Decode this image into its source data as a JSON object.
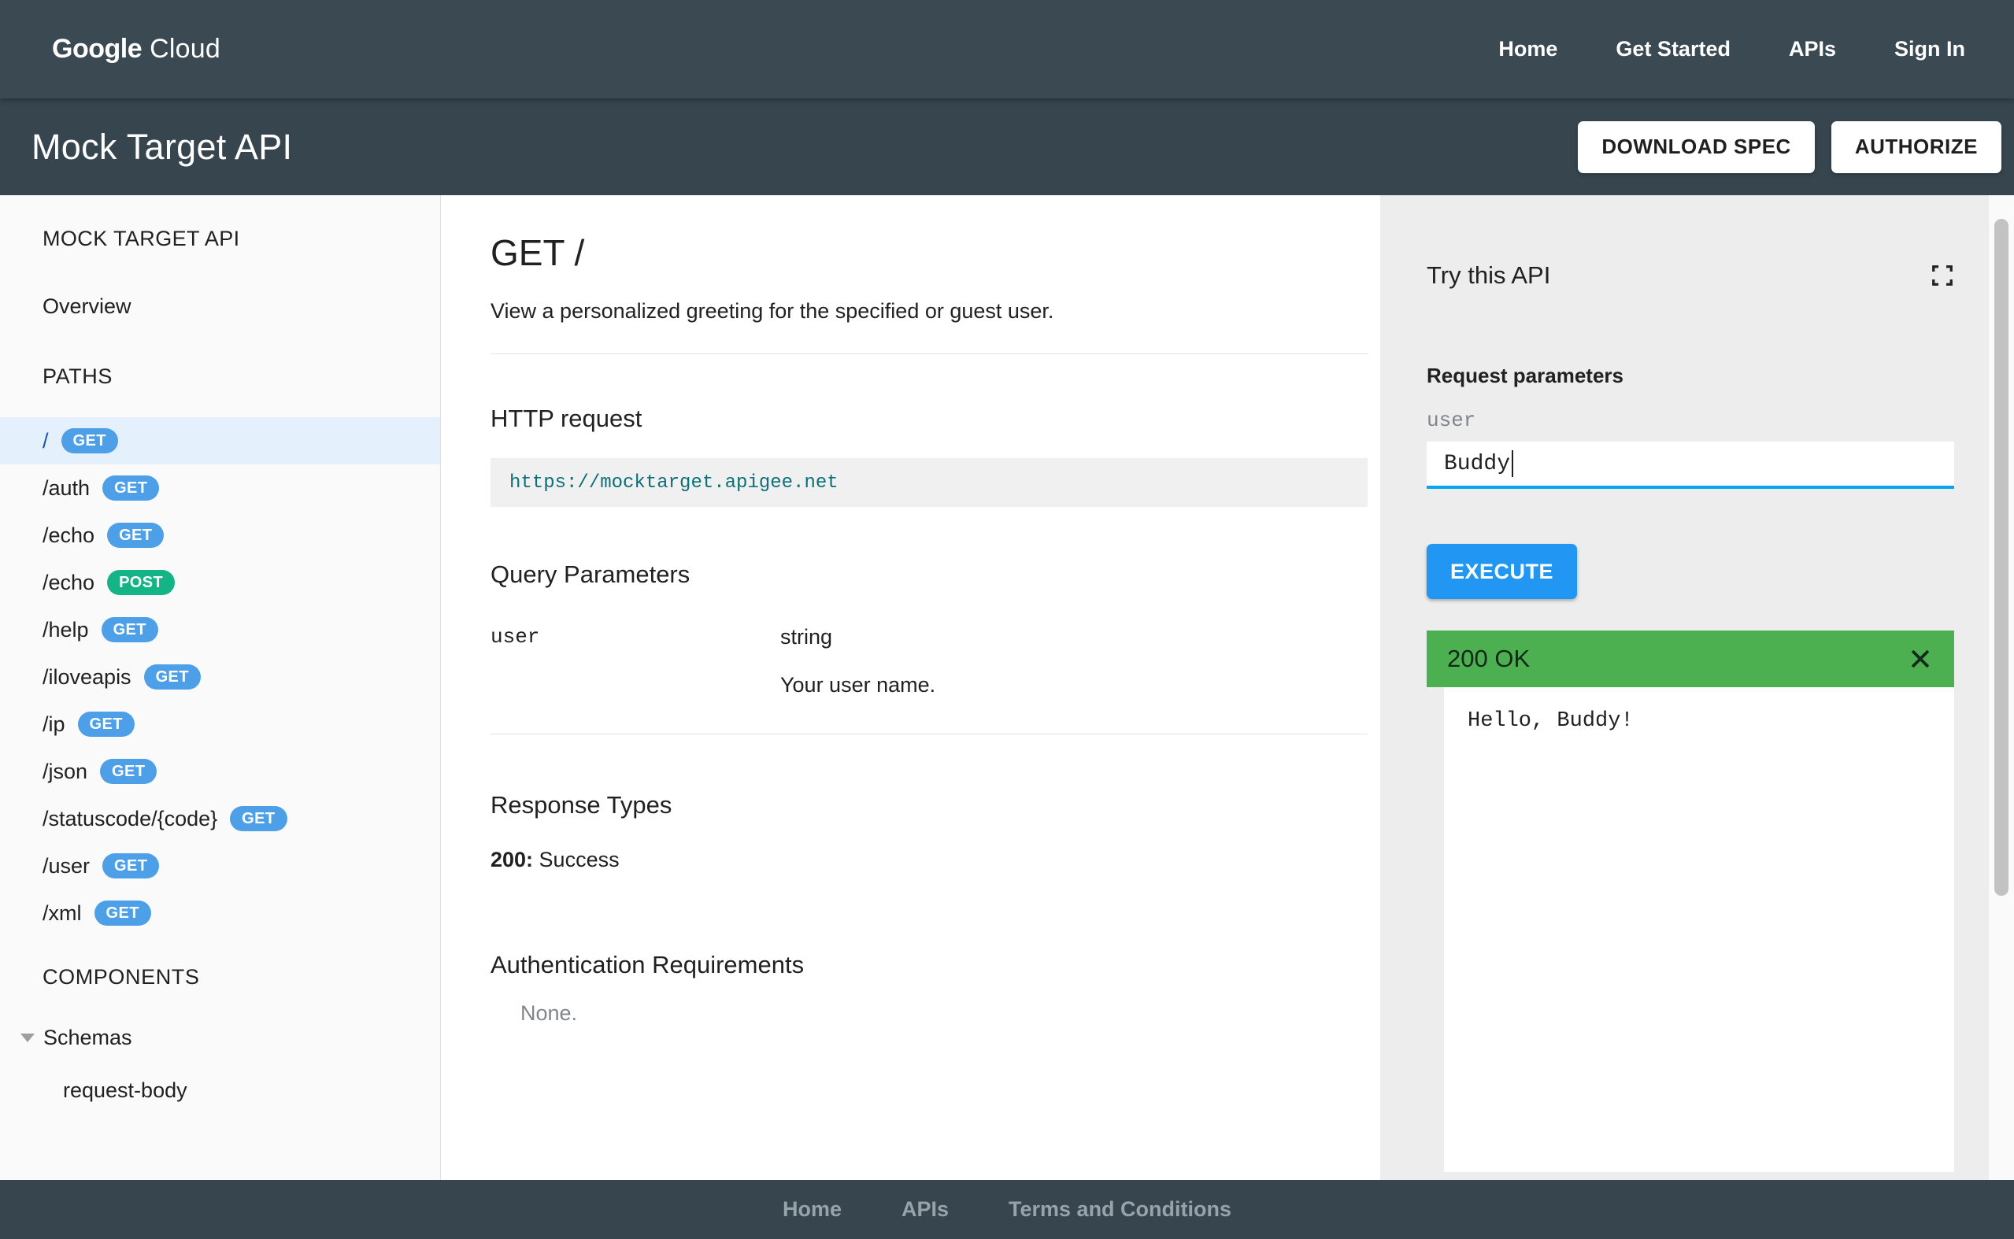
{
  "topnav": {
    "brand": {
      "part1": "Google",
      "part2": "Cloud"
    },
    "links": [
      {
        "label": "Home"
      },
      {
        "label": "Get Started"
      },
      {
        "label": "APIs"
      },
      {
        "label": "Sign In"
      }
    ]
  },
  "banner": {
    "title": "Mock Target API",
    "download_spec_label": "DOWNLOAD SPEC",
    "authorize_label": "AUTHORIZE"
  },
  "sidebar": {
    "api_title": "MOCK TARGET API",
    "overview_label": "Overview",
    "paths_heading": "PATHS",
    "paths": [
      {
        "path": "/",
        "method": "GET",
        "active": true
      },
      {
        "path": "/auth",
        "method": "GET"
      },
      {
        "path": "/echo",
        "method": "GET"
      },
      {
        "path": "/echo",
        "method": "POST"
      },
      {
        "path": "/help",
        "method": "GET"
      },
      {
        "path": "/iloveapis",
        "method": "GET"
      },
      {
        "path": "/ip",
        "method": "GET"
      },
      {
        "path": "/json",
        "method": "GET"
      },
      {
        "path": "/statuscode/{code}",
        "method": "GET"
      },
      {
        "path": "/user",
        "method": "GET"
      },
      {
        "path": "/xml",
        "method": "GET"
      }
    ],
    "components_heading": "COMPONENTS",
    "schemas_label": "Schemas",
    "schema_items": [
      {
        "label": "request-body"
      }
    ]
  },
  "main": {
    "title": "GET /",
    "description": "View a personalized greeting for the specified or guest user.",
    "http_request_heading": "HTTP request",
    "http_request_url": "https://mocktarget.apigee.net",
    "query_params_heading": "Query Parameters",
    "query_params": [
      {
        "name": "user",
        "type": "string",
        "description": "Your user name."
      }
    ],
    "response_types_heading": "Response Types",
    "response_types": [
      {
        "code": "200:",
        "label": " Success"
      }
    ],
    "auth_heading": "Authentication Requirements",
    "auth_value": "None."
  },
  "try_panel": {
    "title": "Try this API",
    "request_parameters_label": "Request parameters",
    "fields": [
      {
        "label": "user",
        "value": "Buddy"
      }
    ],
    "execute_label": "EXECUTE",
    "response_status": "200 OK",
    "response_body": "Hello, Buddy!"
  },
  "footer": {
    "links": [
      {
        "label": "Home"
      },
      {
        "label": "APIs"
      },
      {
        "label": "Terms and Conditions"
      }
    ]
  },
  "colors": {
    "header_dark": "#36454E",
    "get_badge": "#4D9FE8",
    "post_badge": "#14B487",
    "active_row": "#E4F0FB",
    "execute_blue": "#2196F3",
    "status_green": "#4CAF50",
    "input_underline": "#05A6F0",
    "url_teal": "#0B7077",
    "panel_gray": "#EDEDED"
  }
}
